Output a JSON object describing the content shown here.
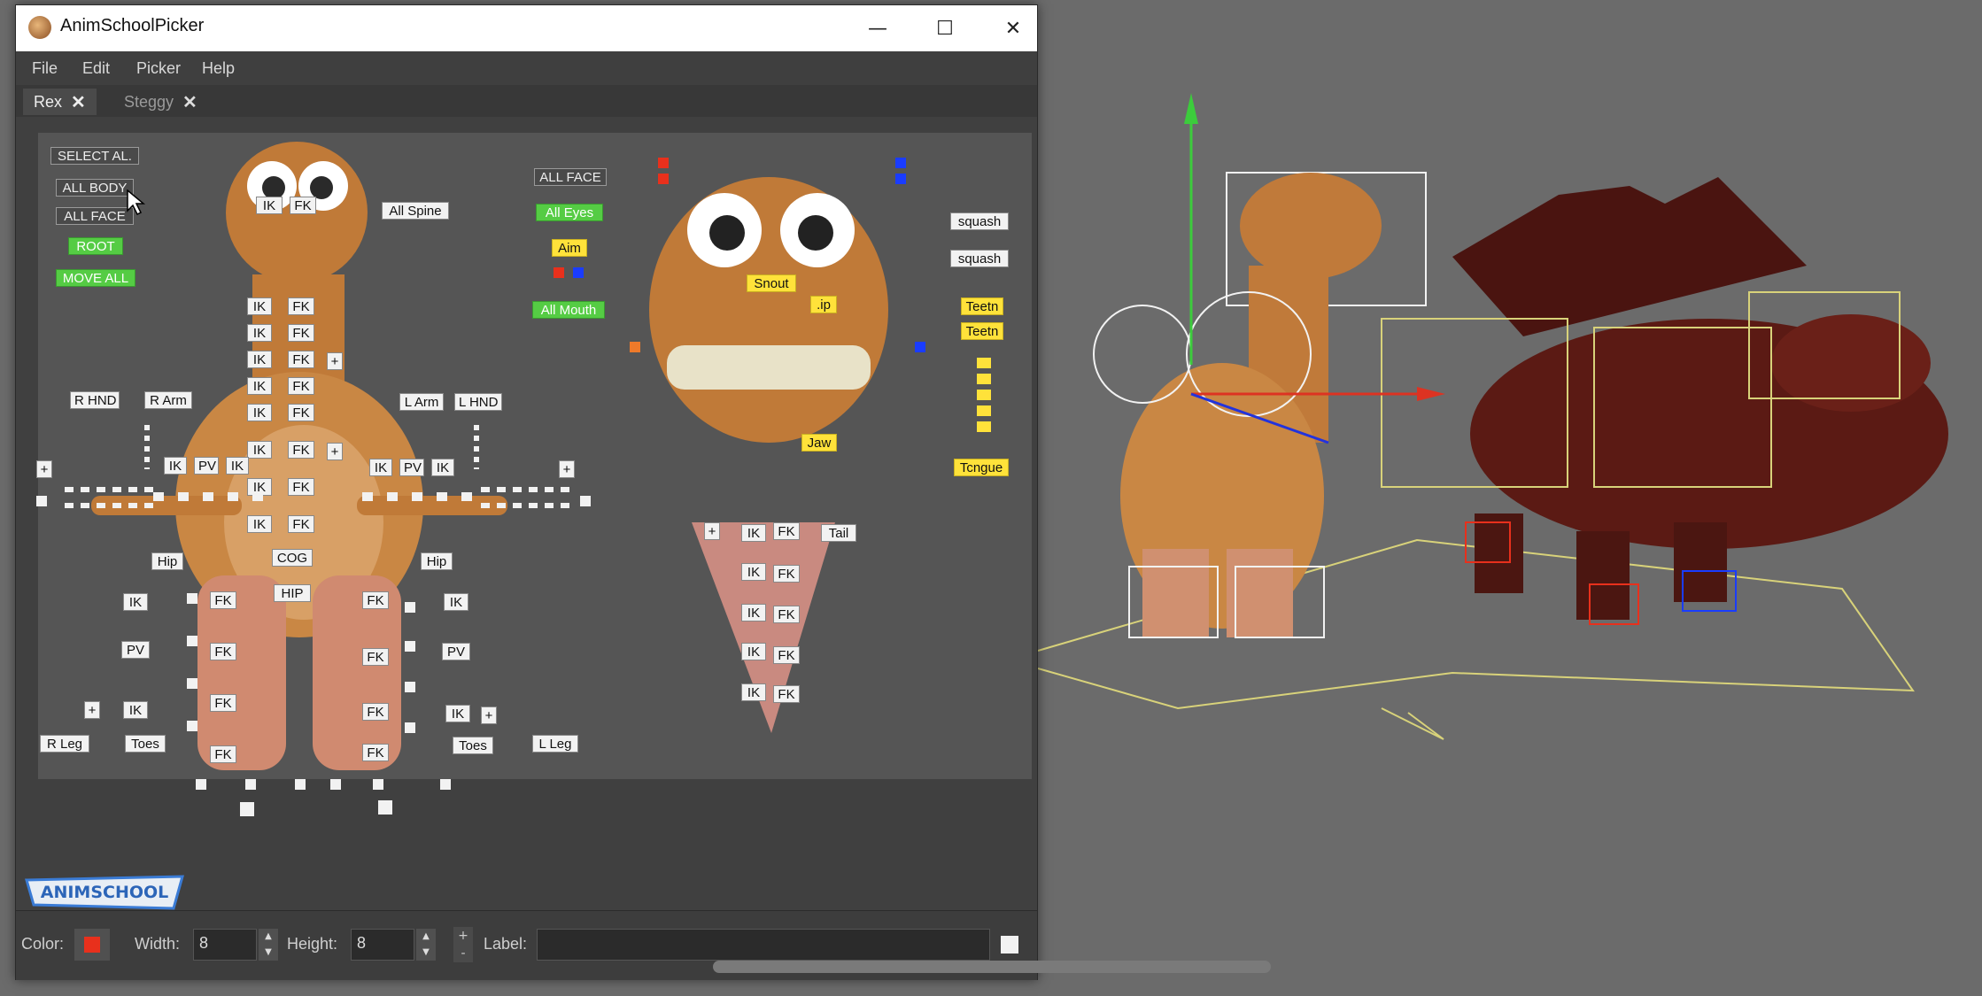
{
  "window": {
    "title": "AnimSchoolPicker",
    "controls": {
      "minimize": "—",
      "maximize": "☐",
      "close": "✕"
    }
  },
  "menu": [
    "File",
    "Edit",
    "Picker",
    "Help"
  ],
  "tabs": [
    {
      "label": "Rex",
      "active": true
    },
    {
      "label": "Steggy",
      "active": false
    }
  ],
  "tab_close_glyph": "✕",
  "picker": {
    "body_left": {
      "select_all": "SELECT AL.",
      "all_body": "ALL BODY",
      "all_face": "ALL FACE",
      "root": "ROOT",
      "move_all": "MOVE ALL",
      "all_spine": "All Spine",
      "r_hnd": "R HND",
      "r_arm": "R Arm",
      "l_arm": "L Arm",
      "l_hnd": "L HND",
      "ik": "IK",
      "fk": "FK",
      "pv": "PV",
      "plus": "+",
      "hip": "Hip",
      "cog": "COG",
      "hip_caps": "HIP",
      "r_leg": "R Leg",
      "toes": "Toes",
      "l_leg": "L Leg"
    },
    "face": {
      "all_face": "ALL FACE",
      "all_eyes": "All Eyes",
      "aim": "Aim",
      "all_mouth": "All Mouth",
      "snout": "Snout",
      "lip": ".ip",
      "jaw": "Jaw",
      "squash1": "squash",
      "squash2": "squash",
      "teeth1": "Teetn",
      "teeth2": "Teetn",
      "tongue": "Tcngue"
    },
    "tail": {
      "label": "Tail"
    }
  },
  "logo_text": "ANIMSCHOOL",
  "bottom": {
    "color_label": "Color:",
    "color_value": "#e8301c",
    "width_label": "Width:",
    "width_value": "8",
    "height_label": "Height:",
    "height_value": "8",
    "plus": "+",
    "minus": "-",
    "label_label": "Label:",
    "label_value": ""
  },
  "colors": {
    "green_button": "#55cc44",
    "yellow_button": "#ffe23a",
    "red_control": "#e8301c",
    "blue_control": "#1a3cff",
    "viewport_bg": "#6b6b6b"
  }
}
